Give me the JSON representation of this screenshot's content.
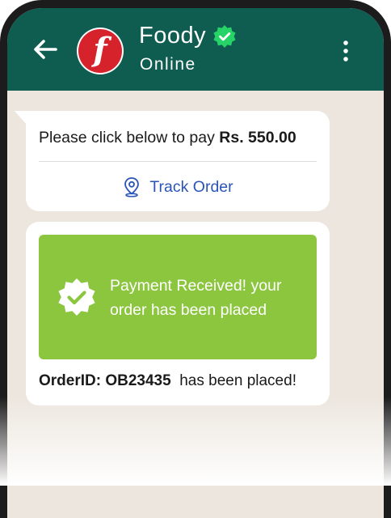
{
  "header": {
    "back_icon": "arrow-left-icon",
    "avatar_icon": "foody-logo-f",
    "avatar_letter": "f",
    "title": "Foody",
    "verified_icon": "verified-badge-icon",
    "status": "Online",
    "menu_icon": "more-vertical-icon"
  },
  "messages": {
    "payment_request": {
      "text": "Please click below to pay ",
      "amount": "Rs. 550.00",
      "action_icon": "location-pin-icon",
      "action_label": "Track Order"
    },
    "confirmation": {
      "badge_icon": "check-badge-icon",
      "card_text": "Payment Received! your order has been placed",
      "order_label": "OrderID: OB23435",
      "order_suffix": "  has been placed!"
    }
  },
  "colors": {
    "header_bg": "#0f5c50",
    "chat_bg": "#ece6de",
    "brand_red": "#d6222b",
    "verified_green": "#25d366",
    "card_green": "#8cc63f",
    "link_blue": "#2a55b8"
  }
}
